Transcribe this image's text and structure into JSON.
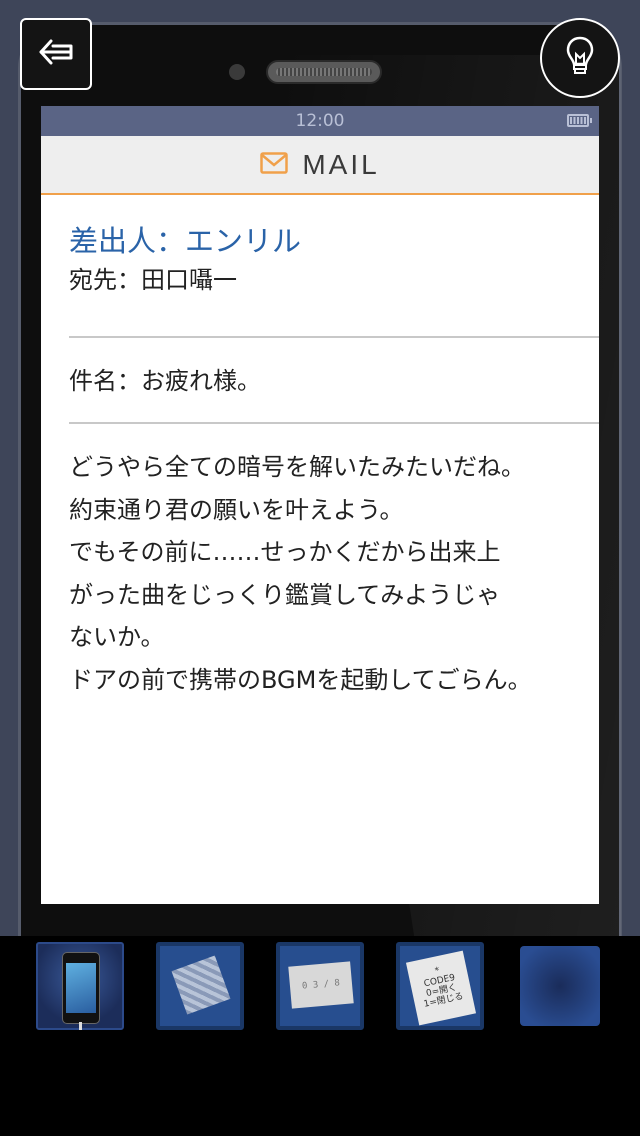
{
  "status_bar": {
    "time": "12:00"
  },
  "mail": {
    "app_title": "MAIL",
    "from": "差出人：エンリル",
    "to": "宛先：田口囁一",
    "subject": "件名：お疲れ様。",
    "body": [
      "どうやら全ての暗号を解いたみたいだね。",
      "約束通り君の願いを叶えよう。",
      "でもその前に……せっかくだから出来上",
      "がった曲をじっくり鑑賞してみようじゃ",
      "ないか。",
      "ドアの前で携帯のBGMを起動してごらん。"
    ]
  },
  "controls": {
    "back_icon": "back-arrow-icon",
    "hint_icon": "lightbulb-icon"
  },
  "inventory": {
    "items": [
      {
        "name": "smartphone"
      },
      {
        "name": "photo"
      },
      {
        "name": "note",
        "text": "0 3 / 8"
      },
      {
        "name": "code-note",
        "lines": [
          "*",
          "CODE9",
          "0=開く",
          "1=閉じる"
        ]
      },
      {
        "name": "empty"
      }
    ]
  },
  "colors": {
    "accent": "#f0a04a",
    "sender": "#2a63a8",
    "status_bar": "#5a6485"
  }
}
